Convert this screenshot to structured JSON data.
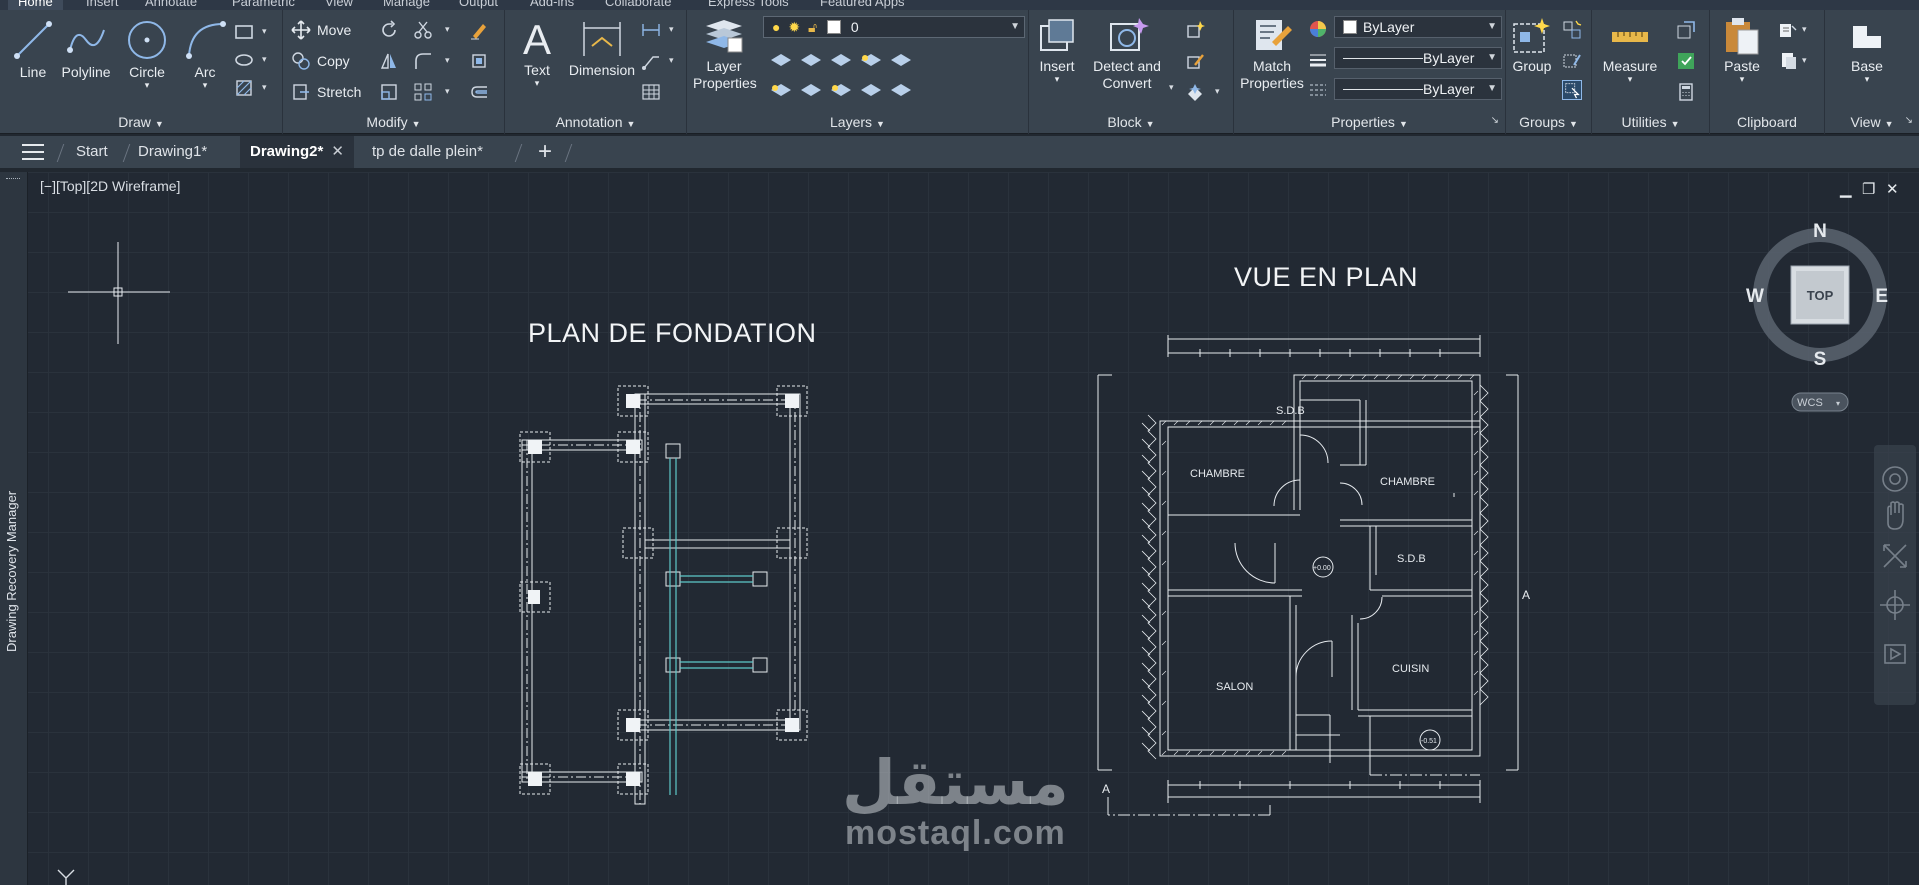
{
  "menubar": {
    "tabs": [
      "Home",
      "Insert",
      "Annotate",
      "Parametric",
      "View",
      "Manage",
      "Output",
      "Add-ins",
      "Collaborate",
      "Express Tools",
      "Featured Apps"
    ]
  },
  "ribbon": {
    "draw": {
      "title": "Draw",
      "line": "Line",
      "polyline": "Polyline",
      "circle": "Circle",
      "arc": "Arc"
    },
    "modify": {
      "title": "Modify",
      "move": "Move",
      "copy": "Copy",
      "stretch": "Stretch"
    },
    "annotation": {
      "title": "Annotation",
      "text": "Text",
      "dimension": "Dimension"
    },
    "layers": {
      "title": "Layers",
      "layer_properties_line1": "Layer",
      "layer_properties_line2": "Properties",
      "current_layer": "0"
    },
    "block": {
      "title": "Block",
      "insert": "Insert",
      "detect_line1": "Detect and",
      "detect_line2": "Convert"
    },
    "properties": {
      "title": "Properties",
      "match_line1": "Match",
      "match_line2": "Properties",
      "color": "ByLayer",
      "linetype": "ByLayer",
      "lineweight": "ByLayer"
    },
    "groups": {
      "title": "Groups",
      "group": "Group"
    },
    "utilities": {
      "title": "Utilities",
      "measure": "Measure"
    },
    "clipboard": {
      "title": "Clipboard",
      "paste": "Paste"
    },
    "view": {
      "title": "View",
      "base": "Base"
    }
  },
  "doc_tabs": {
    "start": "Start",
    "tabs": [
      {
        "label": "Drawing1*"
      },
      {
        "label": "Drawing2*"
      },
      {
        "label": "tp de dalle plein*"
      }
    ],
    "close": "✕",
    "add": "+"
  },
  "viewport": {
    "label": "[−][Top][2D Wireframe]",
    "side_panel": "Drawing Recovery Manager"
  },
  "viewcube": {
    "north": "N",
    "south": "S",
    "east": "E",
    "west": "W",
    "face": "TOP",
    "wcs": "WCS"
  },
  "drawing": {
    "plan1_title": "PLAN DE FONDATION",
    "plan2_title": "VUE EN PLAN",
    "rooms": [
      "S.D.B",
      "CHAMBRE",
      "CHAMBRE",
      "S.D.B",
      "SALON",
      "CUISIN"
    ],
    "levels": [
      "+0.00",
      "-0.51"
    ],
    "section_marker": "A"
  },
  "watermark": {
    "arabic": "مستقل",
    "latin": "mostaql.com"
  }
}
